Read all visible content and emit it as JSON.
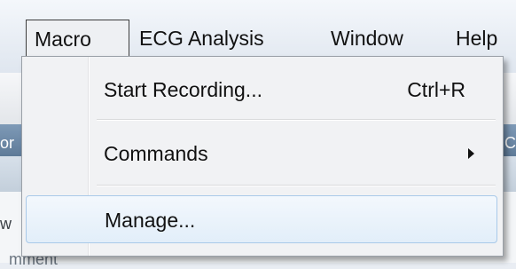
{
  "menubar": {
    "items": [
      {
        "label": "Macro",
        "active": true
      },
      {
        "label": "ECG Analysis"
      },
      {
        "label": "Window"
      },
      {
        "label": "Help"
      }
    ]
  },
  "dropdown": {
    "items": [
      {
        "label": "Start Recording...",
        "shortcut": "Ctrl+R"
      },
      {
        "label": "Commands",
        "submenu": true,
        "icon": "chevron-right-icon"
      },
      {
        "label": "Manage...",
        "highlighted": true
      }
    ]
  },
  "background": {
    "fragment_left_1": "or",
    "fragment_left_2": "w",
    "fragment_right_1": "C",
    "fragment_bottom": "mment"
  },
  "colors": {
    "highlight_border": "#a9c9e9",
    "menu_background": "#f1f2f4",
    "ribbon": "#6e8aa8"
  }
}
